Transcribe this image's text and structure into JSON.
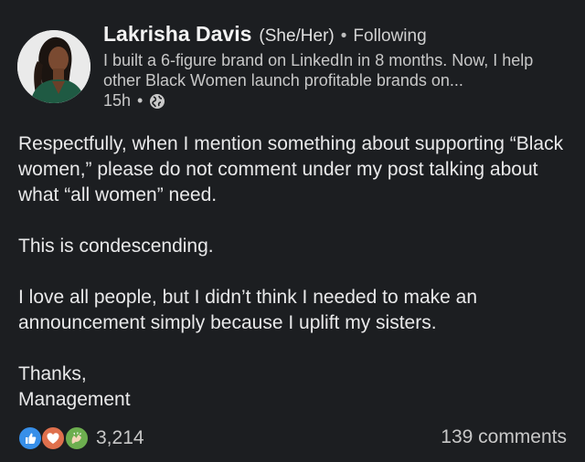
{
  "author": {
    "name": "Lakrisha Davis",
    "pronouns": "(She/Her)",
    "separator": "•",
    "follow_state": "Following",
    "headline": "I built a 6-figure brand on LinkedIn in 8 months. Now, I help other Black Women launch profitable brands on...",
    "timestamp": "15h",
    "meta_separator": "•",
    "visibility_icon": "globe-icon"
  },
  "post": {
    "paragraphs": [
      "Respectfully, when I mention something about supporting “Black women,” please do not comment under my post talking about what “all women” need.",
      "This is condescending.",
      "I love all people, but I didn’t think I needed to make an announcement simply because I uplift my sisters.",
      "Thanks,",
      "Management"
    ]
  },
  "footer": {
    "reaction_icons": [
      "like-icon",
      "love-icon",
      "celebrate-icon"
    ],
    "reaction_count": "3,214",
    "comments_label": "139 comments"
  },
  "colors": {
    "background": "#1c1e21",
    "like": "#378fe9",
    "love": "#df704d",
    "celebrate": "#6dae4f"
  }
}
